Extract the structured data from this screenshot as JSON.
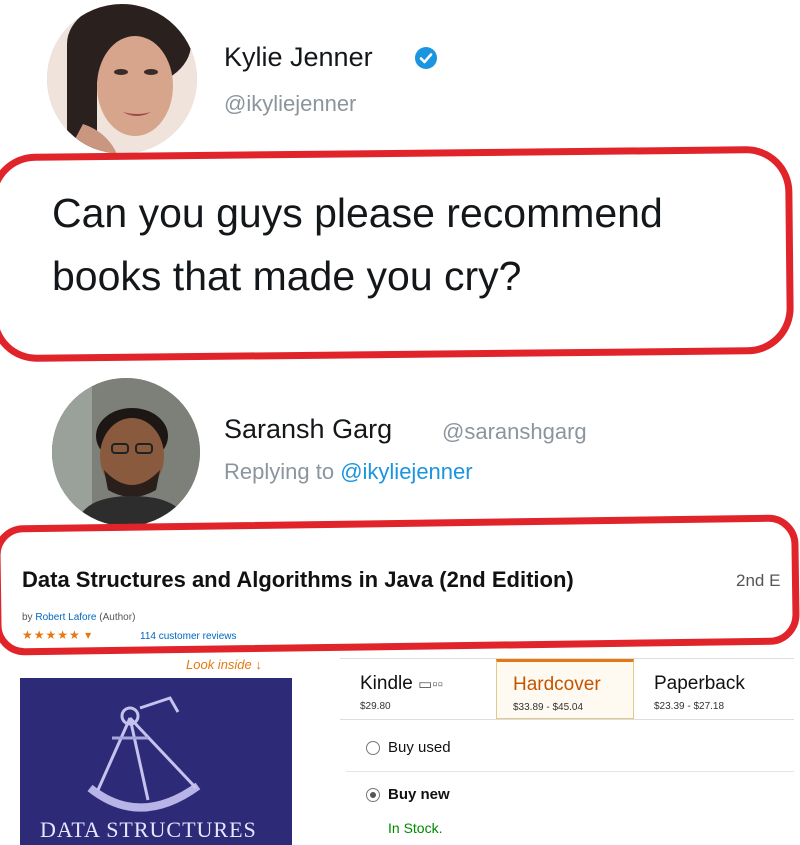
{
  "tweet": {
    "author_name": "Kylie Jenner",
    "author_handle": "@ikyliejenner",
    "text_line1": "Can you guys please recommend",
    "text_line2": "books that made you cry?"
  },
  "reply": {
    "author_name": "Saransh Garg",
    "author_handle": "@saranshgarg",
    "replying_prefix": "Replying to",
    "replying_to": "@ikyliejenner"
  },
  "listing": {
    "title": "Data Structures and Algorithms in Java (2nd Edition)",
    "edition": "2nd E",
    "byline_prefix": "by",
    "author": "Robert Lafore",
    "author_role": "(Author)",
    "stars": "★★★★★ ▾",
    "reviews": "114 customer reviews",
    "look_inside": "Look inside",
    "cover_title": "DATA STRUCTURES",
    "formats": [
      {
        "label": "Kindle",
        "price": "$29.80"
      },
      {
        "label": "Hardcover",
        "price": "$33.89 - $45.04"
      },
      {
        "label": "Paperback",
        "price": "$23.39 - $27.18"
      }
    ],
    "buy_used": "Buy used",
    "buy_new": "Buy new",
    "stock": "In Stock."
  },
  "colors": {
    "twitter_blue": "#1b95e0",
    "annotation_red": "#e1232a",
    "amazon_orange": "#e47911",
    "cover_navy": "#2d2b78"
  }
}
